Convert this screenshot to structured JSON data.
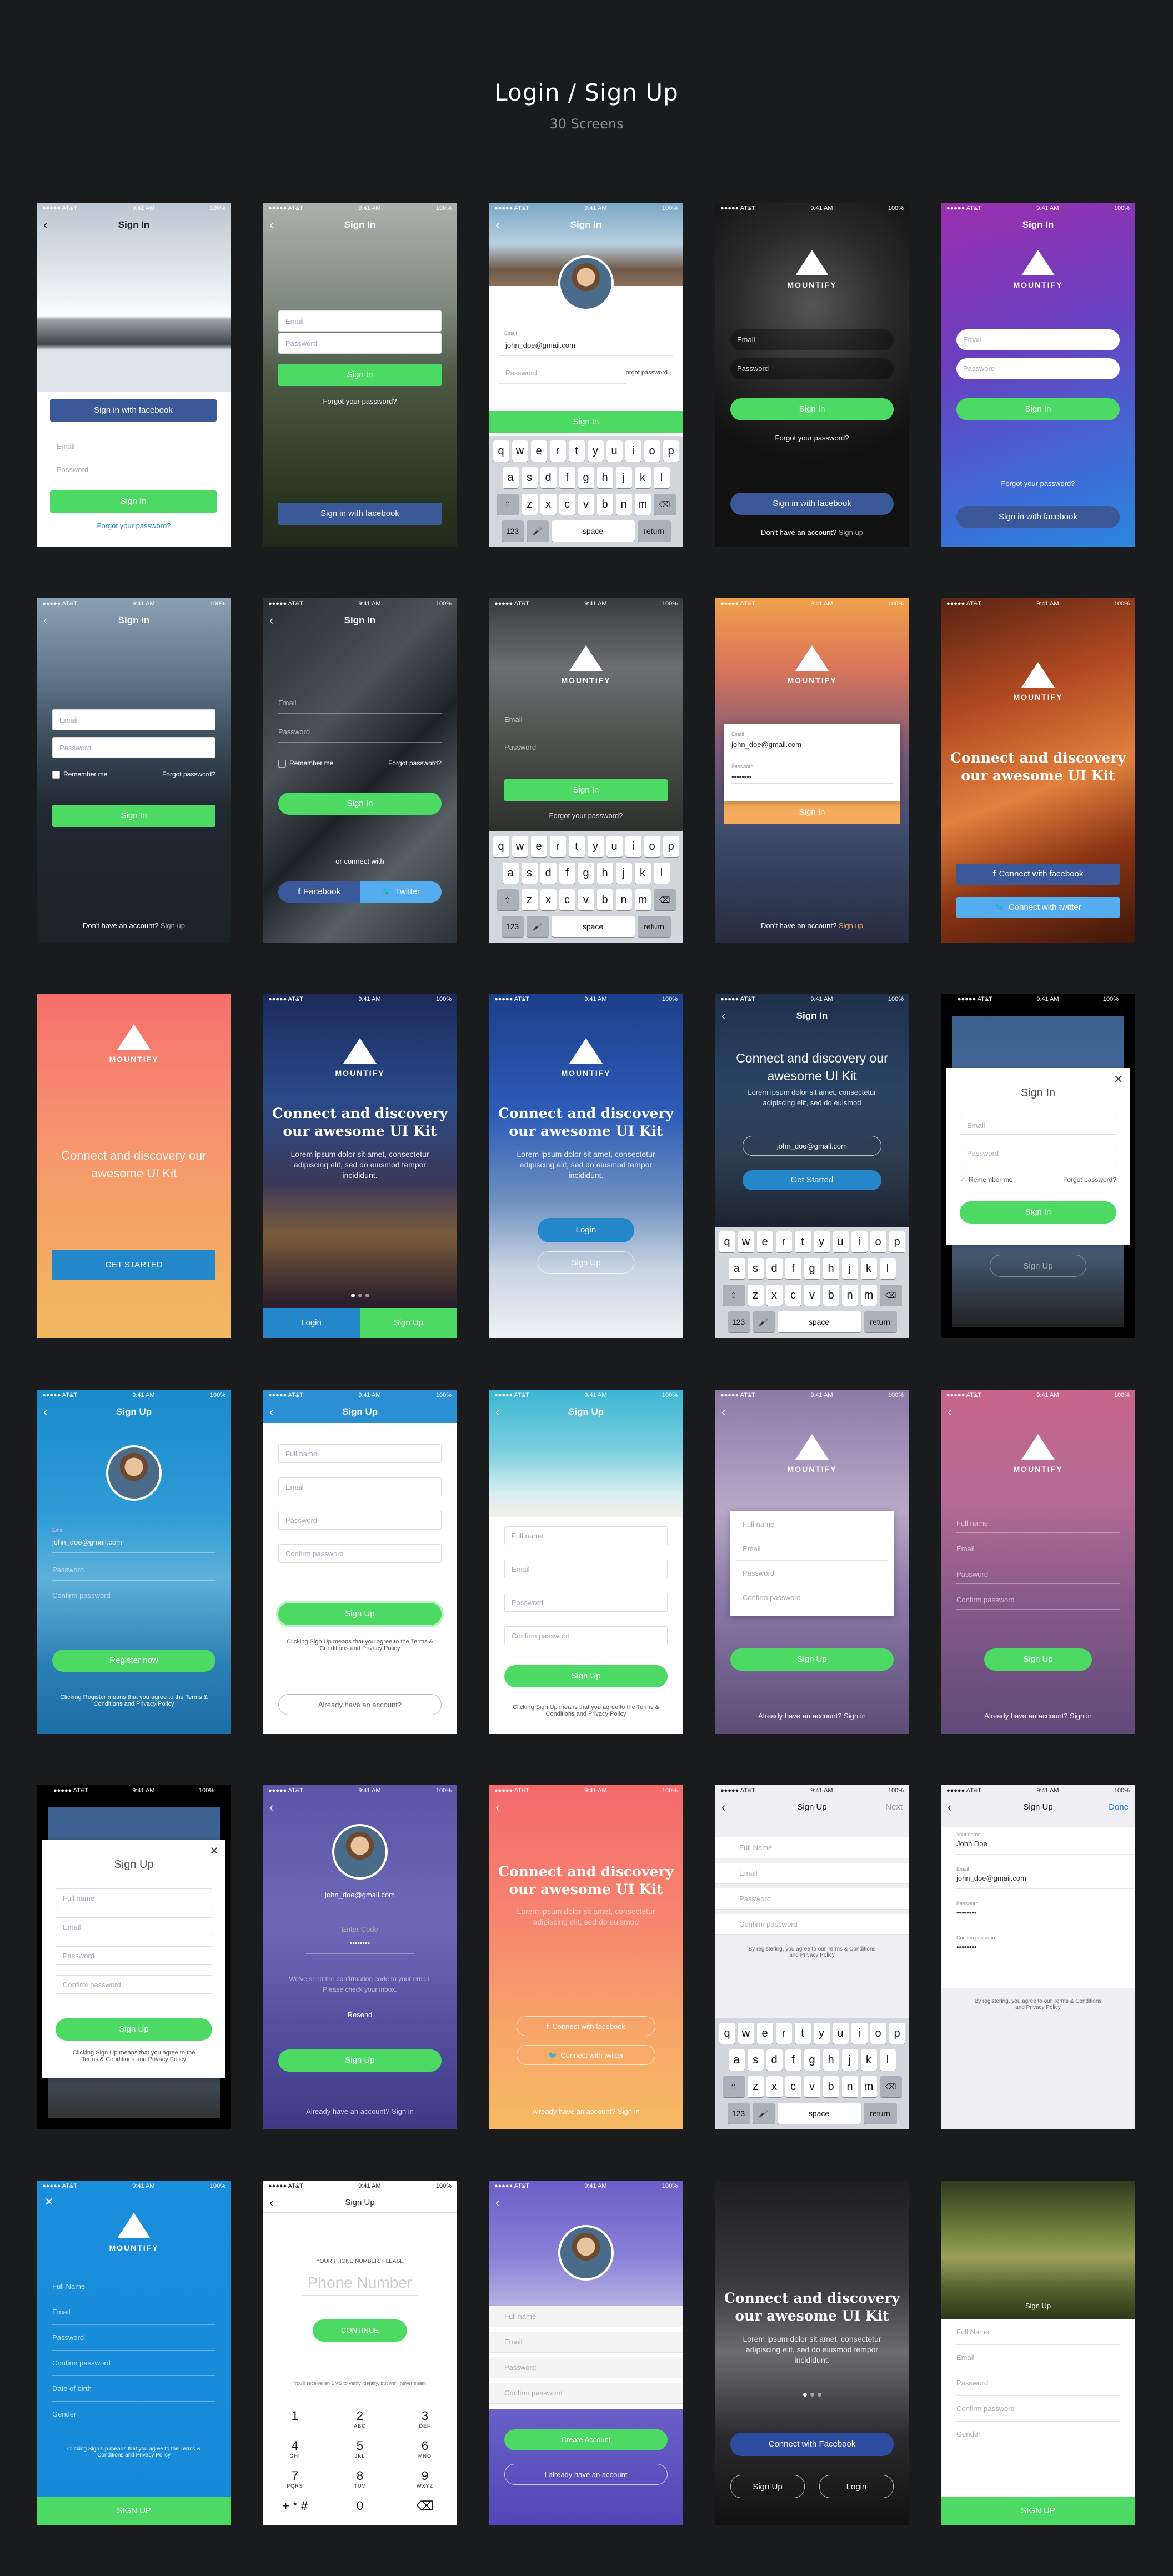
{
  "header": {
    "title": "Login / Sign Up",
    "subtitle": "30 Screens"
  },
  "status": {
    "carrier": "●●●●● AT&T",
    "time": "9:41 AM",
    "battery": "100%"
  },
  "common": {
    "sign_in": "Sign In",
    "sign_up": "Sign Up",
    "email": "Email",
    "password": "Password",
    "forgot": "Forgot your password?",
    "forgot_short": "Forgot password?",
    "fb_sign_in": "Sign in with facebook",
    "brand": "MOUNTIFY",
    "no_account": "Don't have an account?",
    "signup_link": "Sign up",
    "tagline": "Connect and discovery our awesome UI Kit",
    "lorem": "Lorem ipsum dolor sit amet, consectetur adipiscing elit, sed do eiusmod tempor incididunt.",
    "full_name": "Full name",
    "confirm": "Confirm password",
    "already": "Already have an account? Sign in",
    "remember": "Remember me",
    "sample_email": "john_doe@gmail.com",
    "dots": "••••••••"
  },
  "s3": {
    "email_label": "Email",
    "password_label": "Password",
    "forgot": "Forgot password"
  },
  "s7": {
    "connect_with": "or connect with",
    "facebook": "Facebook",
    "twitter": "Twitter"
  },
  "s10": {
    "connect_fb": "Connect with facebook",
    "connect_tw": "Connect with twitter"
  },
  "s11": {
    "cta": "GET STARTED"
  },
  "s12": {
    "login": "Login",
    "signup": "Sign Up",
    "body": "Lorem ipsum dolor sit amet, consectetur adipiscing elit, sed do eiusmod tempor incididunt."
  },
  "s14": {
    "cta": "Get Started",
    "body": "Lorem ipsum dolor sit amet, consectetur adipiscing elit, sed do euismod"
  },
  "s16": {
    "cta": "Register now",
    "terms": "Clicking Register means that you agree to the Terms & Conditions and Privacy Policy"
  },
  "s17": {
    "terms": "Clicking Sign Up means that you agree to the Terms & Conditions and Privacy Policy",
    "already": "Already have an account?"
  },
  "s22": {
    "code_label": "Enter Code",
    "notice": "We've send the confirmation code to your email. Please check your inbox.",
    "resend": "Resend"
  },
  "s24": {
    "next": "Next",
    "terms": "By registering, you agree to our Terms & Conditions and Privacy Policy"
  },
  "s25": {
    "done": "Done",
    "your_name": "Your name",
    "name_val": "John Doe",
    "email_label": "Email",
    "password_label": "Password",
    "confirm_label": "Confirm password",
    "terms": "By registering, you agree to our Terms & Conditions and Privacy Policy"
  },
  "s26": {
    "fields": [
      "Full Name",
      "Email",
      "Password",
      "Confirm password",
      "Date of birth",
      "Gender"
    ],
    "cta": "SIGN UP",
    "terms": "Clicking Sign Up means that you agree to the Terms & Conditions and Privacy Policy"
  },
  "s27": {
    "prompt": "YOUR PHONE NUMBER, PLEASE",
    "placeholder": "Phone Number",
    "cta": "CONTINUE",
    "note": "You'll receive an SMS to verify identity, but we'll never spam",
    "keys": [
      [
        "1",
        ""
      ],
      [
        "2",
        "ABC"
      ],
      [
        "3",
        "DEF"
      ],
      [
        "4",
        "GHI"
      ],
      [
        "5",
        "JKL"
      ],
      [
        "6",
        "MNO"
      ],
      [
        "7",
        "PQRS"
      ],
      [
        "8",
        "TUV"
      ],
      [
        "9",
        "WXYZ"
      ],
      [
        "+ * #",
        ""
      ],
      [
        "0",
        ""
      ],
      [
        "⌫",
        ""
      ]
    ]
  },
  "s28": {
    "create": "Create Account",
    "have": "I already have an account"
  },
  "s29": {
    "connect_fb": "Connect with Facebook",
    "signup": "Sign Up",
    "login": "Login"
  },
  "s30": {
    "fields": [
      "Full Name",
      "Email",
      "Password",
      "Confirm password",
      "Gender"
    ],
    "cta": "SIGN UP"
  },
  "keyboard": {
    "row1": [
      "q",
      "w",
      "e",
      "r",
      "t",
      "y",
      "u",
      "i",
      "o",
      "p"
    ],
    "row2": [
      "a",
      "s",
      "d",
      "f",
      "g",
      "h",
      "j",
      "k",
      "l"
    ],
    "row3": [
      "z",
      "x",
      "c",
      "v",
      "b",
      "n",
      "m"
    ],
    "nums": "123",
    "space": "space",
    "ret": "return"
  }
}
